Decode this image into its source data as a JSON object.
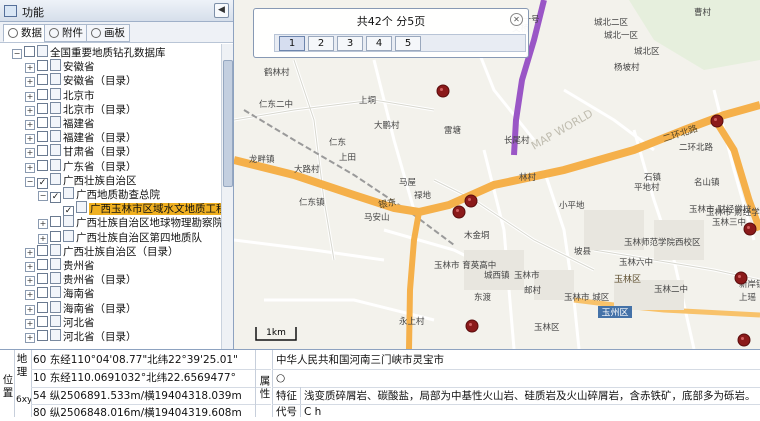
{
  "panel": {
    "title": "功能",
    "collapse": "◀"
  },
  "tabs": [
    {
      "label": "数据"
    },
    {
      "label": "附件"
    },
    {
      "label": "画板"
    }
  ],
  "tree": [
    {
      "label": "全国重要地质钻孔数据库",
      "level": 0,
      "expand": "−",
      "checkbox": false
    },
    {
      "label": "安徽省",
      "level": 1,
      "expand": "+",
      "checkbox": false
    },
    {
      "label": "安徽省（目录）",
      "level": 1,
      "expand": "+",
      "checkbox": false
    },
    {
      "label": "北京市",
      "level": 1,
      "expand": "+",
      "checkbox": false
    },
    {
      "label": "北京市（目录）",
      "level": 1,
      "expand": "+",
      "checkbox": false
    },
    {
      "label": "福建省",
      "level": 1,
      "expand": "+",
      "checkbox": false
    },
    {
      "label": "福建省（目录）",
      "level": 1,
      "expand": "+",
      "checkbox": false
    },
    {
      "label": "甘肃省（目录）",
      "level": 1,
      "expand": "+",
      "checkbox": false
    },
    {
      "label": "广东省（目录）",
      "level": 1,
      "expand": "+",
      "checkbox": false
    },
    {
      "label": "广西壮族自治区",
      "level": 1,
      "expand": "−",
      "checkbox": true
    },
    {
      "label": "广西地质勘查总院",
      "level": 2,
      "expand": "−",
      "checkbox": true
    },
    {
      "label": "广西玉林市区域水文地质工程",
      "level": 3,
      "expand": "",
      "checkbox": true,
      "selected": true
    },
    {
      "label": "广西壮族自治区地球物理勘察院",
      "level": 2,
      "expand": "+",
      "checkbox": false
    },
    {
      "label": "广西壮族自治区第四地质队",
      "level": 2,
      "expand": "+",
      "checkbox": false
    },
    {
      "label": "广西壮族自治区（目录）",
      "level": 1,
      "expand": "+",
      "checkbox": false
    },
    {
      "label": "贵州省",
      "level": 1,
      "expand": "+",
      "checkbox": false
    },
    {
      "label": "贵州省（目录）",
      "level": 1,
      "expand": "+",
      "checkbox": false
    },
    {
      "label": "海南省",
      "level": 1,
      "expand": "+",
      "checkbox": false
    },
    {
      "label": "海南省（目录）",
      "level": 1,
      "expand": "+",
      "checkbox": false
    },
    {
      "label": "河北省",
      "level": 1,
      "expand": "+",
      "checkbox": false
    },
    {
      "label": "河北省（目录）",
      "level": 1,
      "expand": "+",
      "checkbox": false
    }
  ],
  "pager": {
    "summary": "共42个 分5页",
    "pages": [
      "1",
      "2",
      "3",
      "4",
      "5"
    ],
    "active_page": "1",
    "close": "✕"
  },
  "map": {
    "scale": "1km",
    "watermark": "MAP WORLD",
    "place_labels": [
      "鹤林村",
      "仁东二中",
      "上垌",
      "大鹏村",
      "雷塘",
      "仁东",
      "上田",
      "大路村",
      "龙畔镇",
      "马屋",
      "长尾村",
      "林村",
      "仁东镇",
      "禄地",
      "马安山",
      "木金垌",
      "小平地",
      "玉林市 育英高中",
      "玉林市",
      "城西镇",
      "邮村",
      "永上村",
      "玉林区",
      "玉林市 城区",
      "玉林师范学院西校区",
      "平地村",
      "石镇",
      "名山镇",
      "新岸镇",
      "玉林六中",
      "坡县",
      "玉林二中",
      "八一号",
      "交桥",
      "城北二区",
      "城北一区",
      "城北区",
      "杨坡村",
      "曹村",
      "玉林三中",
      "玉林市 财经学校",
      "上瑶",
      "二环北路",
      "玉林市 财经学校",
      "东渡"
    ],
    "road_labels": [
      "二环北路",
      "银东",
      "玉林区",
      "玉州区"
    ]
  },
  "bottom": {
    "position_group": "位置",
    "geo_group": "地理",
    "xy_label": "6xy",
    "coords": [
      {
        "prefix": "60",
        "text": "东经110°04'08.77\"北纬22°39'25.01\""
      },
      {
        "prefix": "10",
        "text": "东经110.0691032°北纬22.6569477°"
      },
      {
        "prefix": "54",
        "text": "纵2506891.533m/横19404318.039m"
      },
      {
        "prefix": "80",
        "text": "纵2506848.016m/横19404319.608m"
      }
    ],
    "attribute_group": "属性",
    "address": "中华人民共和国河南三门峡市灵宝市",
    "address_symbol": "○",
    "feature_label": "特征",
    "feature_text": "浅变质碎屑岩、碳酸盐，局部为中基性火山岩、硅质岩及火山碎屑岩，含赤铁矿，底部多为砾岩。",
    "code_label": "代号",
    "code_value": "C h"
  }
}
